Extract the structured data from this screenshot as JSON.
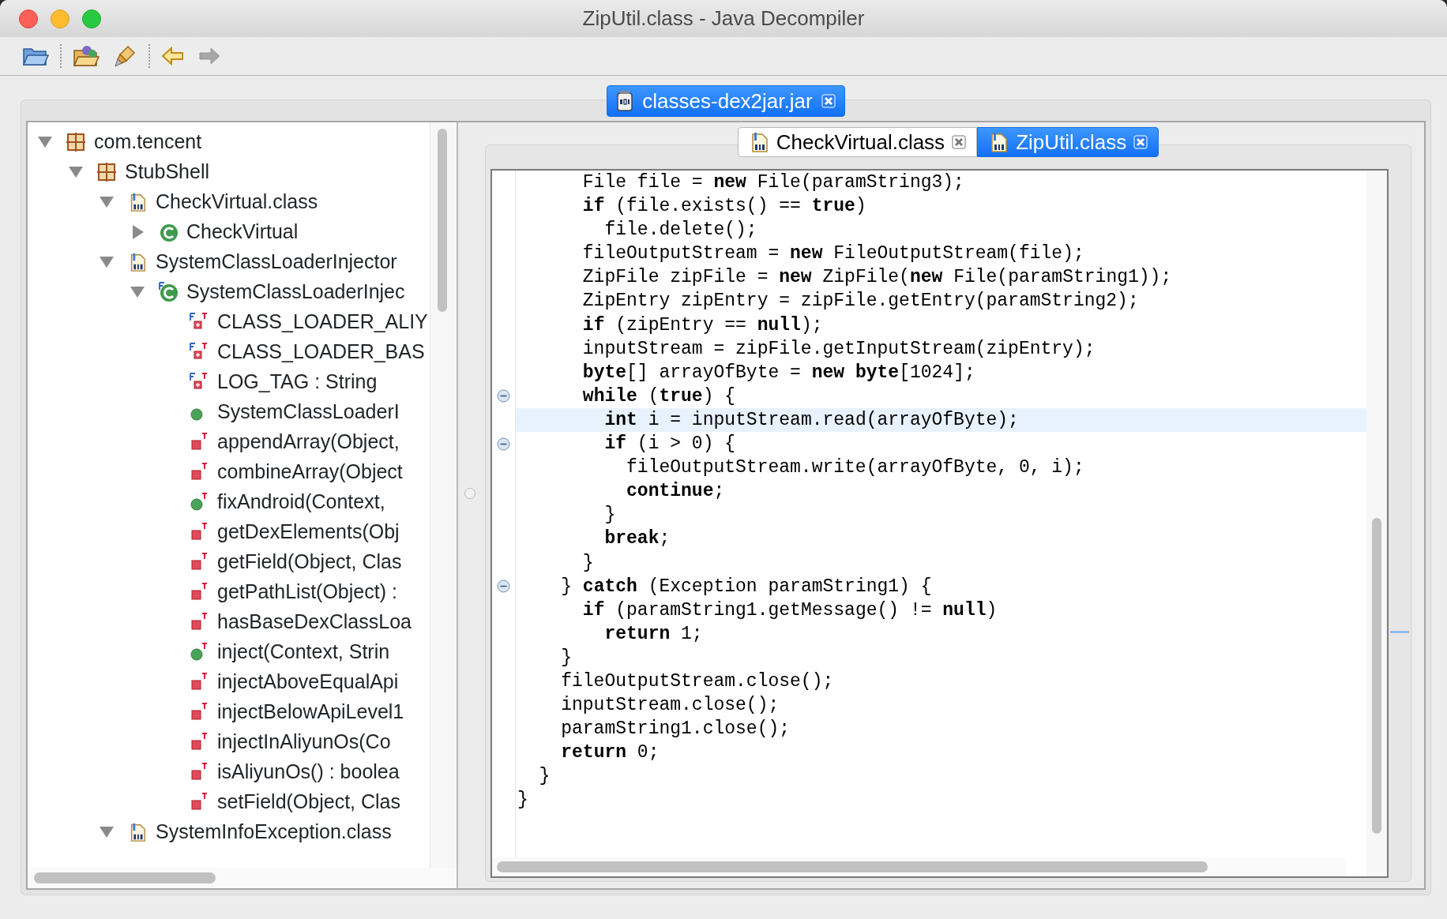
{
  "window": {
    "title": "ZipUtil.class - Java Decompiler"
  },
  "toolbar": [
    {
      "kind": "open",
      "disabled": false
    },
    {
      "kind": "open-type",
      "disabled": false
    },
    {
      "kind": "search",
      "disabled": false
    },
    {
      "kind": "back",
      "disabled": false
    },
    {
      "kind": "forward",
      "disabled": true
    }
  ],
  "file_tabs": [
    {
      "label": "classes-dex2jar.jar",
      "selected": true
    }
  ],
  "tree": [
    {
      "kind": "package",
      "label": "com.tencent",
      "expanded": true,
      "children": [
        {
          "kind": "package",
          "label": "StubShell",
          "expanded": true,
          "children": [
            {
              "kind": "classfile",
              "label": "CheckVirtual.class",
              "expanded": true,
              "children": [
                {
                  "kind": "class",
                  "label": "CheckVirtual",
                  "expanded": false,
                  "final": false
                }
              ]
            },
            {
              "kind": "classfile",
              "label": "SystemClassLoaderInjector",
              "expanded": true,
              "children": [
                {
                  "kind": "class",
                  "label": "SystemClassLoaderInjec",
                  "expanded": true,
                  "final": true,
                  "children": [
                    {
                      "kind": "field",
                      "label": "CLASS_LOADER_ALIY",
                      "static": true
                    },
                    {
                      "kind": "field",
                      "label": "CLASS_LOADER_BAS",
                      "static": true
                    },
                    {
                      "kind": "field",
                      "label": "LOG_TAG : String",
                      "static": true
                    },
                    {
                      "kind": "public_method",
                      "label": "SystemClassLoaderI",
                      "static": false
                    },
                    {
                      "kind": "private_method",
                      "label": "appendArray(Object,",
                      "static": true
                    },
                    {
                      "kind": "private_method",
                      "label": "combineArray(Object",
                      "static": true
                    },
                    {
                      "kind": "public_method",
                      "label": "fixAndroid(Context,",
                      "static": true
                    },
                    {
                      "kind": "private_method",
                      "label": "getDexElements(Obj",
                      "static": true
                    },
                    {
                      "kind": "private_method",
                      "label": "getField(Object, Clas",
                      "static": true
                    },
                    {
                      "kind": "private_method",
                      "label": "getPathList(Object) :",
                      "static": true
                    },
                    {
                      "kind": "private_method",
                      "label": "hasBaseDexClassLoa",
                      "static": true
                    },
                    {
                      "kind": "public_method",
                      "label": "inject(Context, Strin",
                      "static": true
                    },
                    {
                      "kind": "private_method",
                      "label": "injectAboveEqualApi",
                      "static": true
                    },
                    {
                      "kind": "private_method",
                      "label": "injectBelowApiLevel1",
                      "static": true
                    },
                    {
                      "kind": "private_method",
                      "label": "injectInAliyunOs(Co",
                      "static": true
                    },
                    {
                      "kind": "private_method",
                      "label": "isAliyunOs() : boolea",
                      "static": true
                    },
                    {
                      "kind": "private_method",
                      "label": "setField(Object, Clas",
                      "static": true
                    }
                  ]
                }
              ]
            },
            {
              "kind": "classfile",
              "label": "SystemInfoException.class",
              "expanded": true
            }
          ]
        }
      ]
    }
  ],
  "editor_tabs": [
    {
      "label": "CheckVirtual.class",
      "selected": false
    },
    {
      "label": "ZipUtil.class",
      "selected": true
    }
  ],
  "code": [
    {
      "text": "      File file = **new** File(paramString3);",
      "fold": false,
      "highlighted": false
    },
    {
      "text": "      **if** (file.exists() == **true**)",
      "fold": false,
      "highlighted": false
    },
    {
      "text": "        file.delete();",
      "fold": false,
      "highlighted": false
    },
    {
      "text": "      fileOutputStream = **new** FileOutputStream(file);",
      "fold": false,
      "highlighted": false
    },
    {
      "text": "      ZipFile zipFile = **new** ZipFile(**new** File(paramString1));",
      "fold": false,
      "highlighted": false
    },
    {
      "text": "      ZipEntry zipEntry = zipFile.getEntry(paramString2);",
      "fold": false,
      "highlighted": false
    },
    {
      "text": "      **if** (zipEntry == **null**);",
      "fold": false,
      "highlighted": false
    },
    {
      "text": "      inputStream = zipFile.getInputStream(zipEntry);",
      "fold": false,
      "highlighted": false
    },
    {
      "text": "      **byte**[] arrayOfByte = **new** **byte**[1024];",
      "fold": false,
      "highlighted": false
    },
    {
      "text": "      **while** (**true**) {",
      "fold": true,
      "highlighted": false
    },
    {
      "text": "        **int** i = inputStream.read(arrayOfByte);",
      "fold": false,
      "highlighted": true
    },
    {
      "text": "        **if** (i > 0) {",
      "fold": true,
      "highlighted": false
    },
    {
      "text": "          fileOutputStream.write(arrayOfByte, 0, i);",
      "fold": false,
      "highlighted": false
    },
    {
      "text": "          **continue**;",
      "fold": false,
      "highlighted": false
    },
    {
      "text": "        }",
      "fold": false,
      "highlighted": false
    },
    {
      "text": "        **break**;",
      "fold": false,
      "highlighted": false
    },
    {
      "text": "      }",
      "fold": false,
      "highlighted": false
    },
    {
      "text": "    } **catch** (Exception paramString1) {",
      "fold": true,
      "highlighted": false
    },
    {
      "text": "      **if** (paramString1.getMessage() != **null**)",
      "fold": false,
      "highlighted": false
    },
    {
      "text": "        **return** 1;",
      "fold": false,
      "highlighted": false
    },
    {
      "text": "    }",
      "fold": false,
      "highlighted": false
    },
    {
      "text": "    fileOutputStream.close();",
      "fold": false,
      "highlighted": false
    },
    {
      "text": "    inputStream.close();",
      "fold": false,
      "highlighted": false
    },
    {
      "text": "    paramString1.close();",
      "fold": false,
      "highlighted": false
    },
    {
      "text": "    **return** 0;",
      "fold": false,
      "highlighted": false
    },
    {
      "text": "  }",
      "fold": false,
      "highlighted": false
    },
    {
      "text": "}",
      "fold": false,
      "highlighted": false
    }
  ]
}
